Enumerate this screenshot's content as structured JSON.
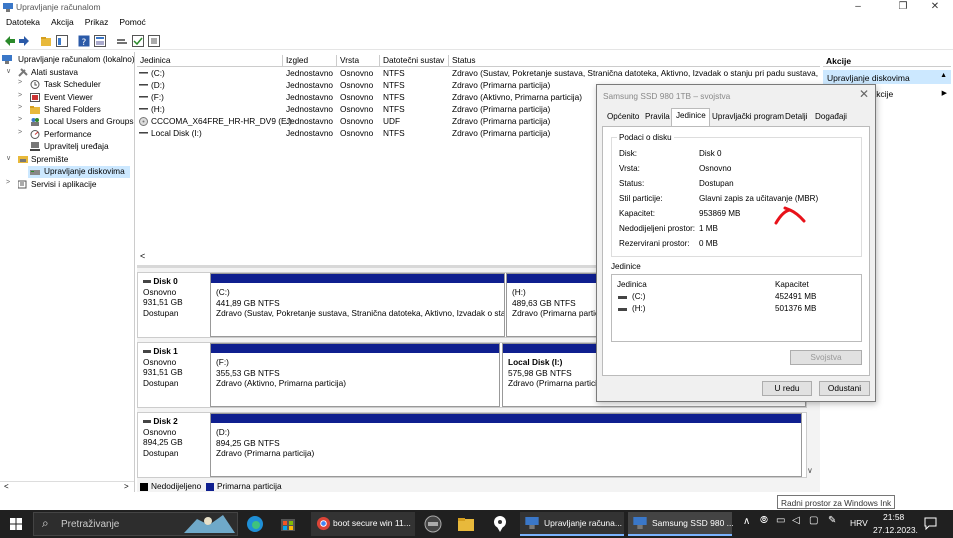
{
  "window": {
    "title": "Upravljanje računalom"
  },
  "menu": [
    "Datoteka",
    "Akcija",
    "Prikaz",
    "Pomoć"
  ],
  "tree": {
    "root": "Upravljanje računalom (lokalno)",
    "items": [
      {
        "label": "Alati sustava",
        "level": 1,
        "expanded": true
      },
      {
        "label": "Task Scheduler",
        "level": 2
      },
      {
        "label": "Event Viewer",
        "level": 2
      },
      {
        "label": "Shared Folders",
        "level": 2
      },
      {
        "label": "Local Users and Groups",
        "level": 2
      },
      {
        "label": "Performance",
        "level": 2
      },
      {
        "label": "Upravitelj uređaja",
        "level": 2
      },
      {
        "label": "Spremište",
        "level": 1,
        "expanded": true
      },
      {
        "label": "Upravljanje diskovima",
        "level": 2,
        "selected": true
      },
      {
        "label": "Servisi i aplikacije",
        "level": 1
      }
    ]
  },
  "volume_list": {
    "headers": [
      "Jedinica",
      "Izgled",
      "Vrsta",
      "Datotečni sustav",
      "Status"
    ],
    "rows": [
      [
        "(C:)",
        "Jednostavno",
        "Osnovno",
        "NTFS",
        "Zdravo (Sustav, Pokretanje sustava, Stranična datoteka, Aktivno, Izvadak o stanju pri padu sustava, I"
      ],
      [
        "(D:)",
        "Jednostavno",
        "Osnovno",
        "NTFS",
        "Zdravo (Primarna particija)"
      ],
      [
        "(F:)",
        "Jednostavno",
        "Osnovno",
        "NTFS",
        "Zdravo (Aktivno, Primarna particija)"
      ],
      [
        "(H:)",
        "Jednostavno",
        "Osnovno",
        "NTFS",
        "Zdravo (Primarna particija)"
      ],
      [
        "CCCOMA_X64FRE_HR-HR_DV9 (E:)",
        "Jednostavno",
        "Osnovno",
        "UDF",
        "Zdravo (Primarna particija)"
      ],
      [
        "Local Disk (I:)",
        "Jednostavno",
        "Osnovno",
        "NTFS",
        "Zdravo (Primarna particija)"
      ]
    ]
  },
  "disks": [
    {
      "name": "Disk 0",
      "type": "Osnovno",
      "size": "931,51 GB",
      "state": "Dostupan",
      "parts": [
        {
          "title": "(C:)",
          "size": "441,89 GB NTFS",
          "status": "Zdravo (Sustav, Pokretanje sustava, Stranična datoteka, Aktivno, Izvadak o sta"
        },
        {
          "title": "(H:)",
          "size": "489,63 GB NTFS",
          "status": "Zdravo (Primarna particija)"
        }
      ]
    },
    {
      "name": "Disk 1",
      "type": "Osnovno",
      "size": "931,51 GB",
      "state": "Dostupan",
      "parts": [
        {
          "title": "(F:)",
          "size": "355,53 GB NTFS",
          "status": "Zdravo (Aktivno, Primarna particija)"
        },
        {
          "title": "Local Disk  (I:)",
          "size": "575,98 GB NTFS",
          "status": "Zdravo (Primarna particija)"
        }
      ]
    },
    {
      "name": "Disk 2",
      "type": "Osnovno",
      "size": "894,25 GB",
      "state": "Dostupan",
      "parts": [
        {
          "title": "(D:)",
          "size": "894,25 GB NTFS",
          "status": "Zdravo (Primarna particija)"
        }
      ]
    }
  ],
  "legend": {
    "unallocated": "Nedodijeljeno",
    "primary": "Primarna particija"
  },
  "actions": {
    "header": "Akcije",
    "section": "Upravljanje diskovima",
    "more": "Dodatne akcije"
  },
  "dialog": {
    "title": "Samsung SSD 980 1TB – svojstva",
    "tabs": [
      "Općenito",
      "Pravila",
      "Jedinice",
      "Upravljački program",
      "Detalji",
      "Događaji"
    ],
    "active_tab": "Jedinice",
    "group_title": "Podaci o disku",
    "info": [
      {
        "k": "Disk:",
        "v": "Disk 0"
      },
      {
        "k": "Vrsta:",
        "v": "Osnovno"
      },
      {
        "k": "Status:",
        "v": "Dostupan"
      },
      {
        "k": "Stil particije:",
        "v": "Glavni zapis za učitavanje (MBR)"
      },
      {
        "k": "Kapacitet:",
        "v": "953869 MB"
      },
      {
        "k": "Nedodijeljeni prostor:",
        "v": "1 MB"
      },
      {
        "k": "Rezervirani prostor:",
        "v": "0 MB"
      }
    ],
    "volumes_label": "Jedinice",
    "volumes_headers": [
      "Jedinica",
      "Kapacitet"
    ],
    "volumes": [
      {
        "name": "(C:)",
        "cap": "452491 MB"
      },
      {
        "name": "(H:)",
        "cap": "501376 MB"
      }
    ],
    "properties_button": "Svojstva",
    "ok_button": "U redu",
    "cancel_button": "Odustani"
  },
  "tooltip": "Radni prostor za Windows Ink",
  "taskbar": {
    "search": "Pretraživanje",
    "items": [
      "boot secure win 11...",
      "Upravljanje računa...",
      "Samsung SSD 980 ..."
    ],
    "lang": "HRV",
    "time": "21:58",
    "date": "27.12.2023."
  },
  "colors": {
    "primary_partition": "#0f1f8f",
    "taskbar": "#202020",
    "selection": "#cce8ff",
    "annotation": "#e8121a"
  }
}
